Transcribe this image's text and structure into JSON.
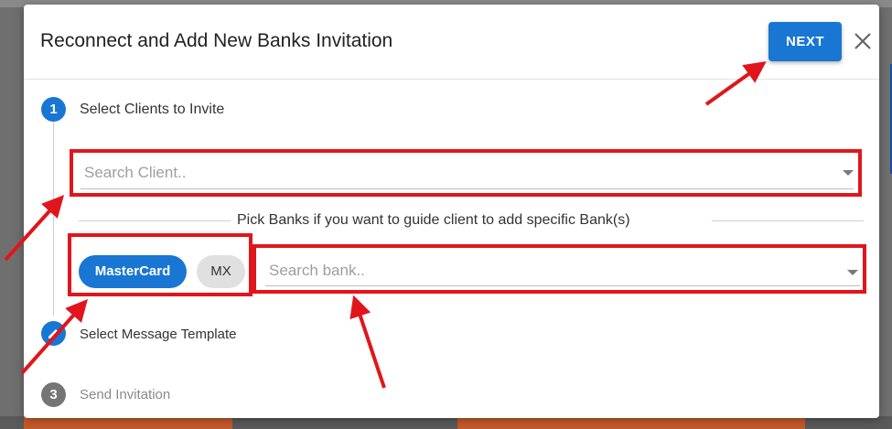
{
  "dialog": {
    "title": "Reconnect and Add New Banks Invitation",
    "next_label": "NEXT",
    "close_icon": "close-icon"
  },
  "steps": [
    {
      "number": "1",
      "label": "Select Clients to Invite",
      "state": "active"
    },
    {
      "number": "2",
      "label": "Select Message Template",
      "state": "edit"
    },
    {
      "number": "3",
      "label": "Send Invitation",
      "state": "inactive"
    }
  ],
  "client_search": {
    "placeholder": "Search Client..",
    "value": ""
  },
  "banks": {
    "hint": "Pick Banks if you want to guide client to add specific Bank(s)",
    "chips": [
      "MasterCard",
      "MX"
    ],
    "search_placeholder": "Search bank..",
    "search_value": ""
  },
  "colors": {
    "primary": "#1976d2",
    "highlight": "#e0161c",
    "inactive_step": "#757575"
  }
}
